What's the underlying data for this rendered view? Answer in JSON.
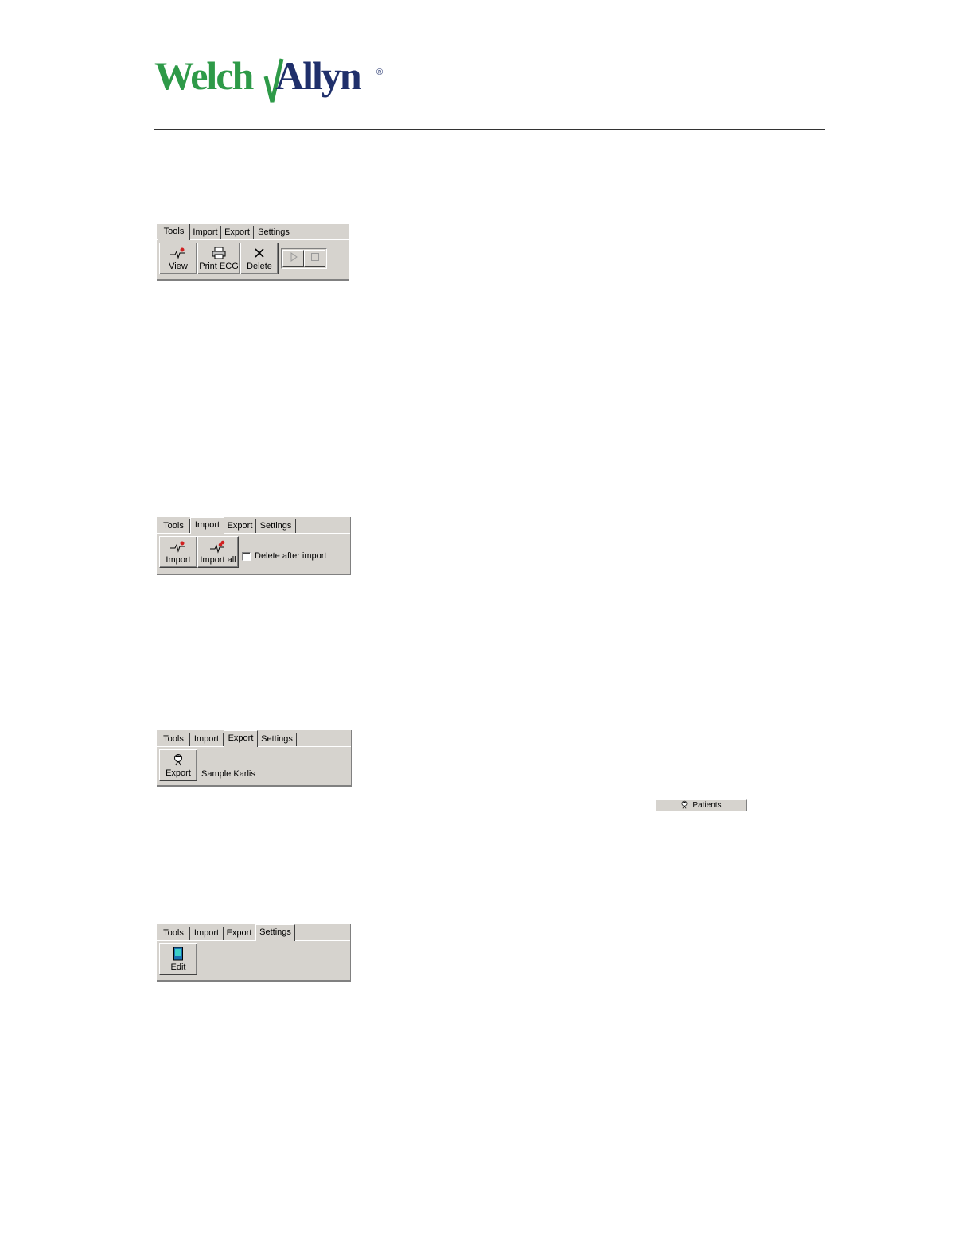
{
  "brand": {
    "logo_text_welch": "Welch",
    "logo_text_allyn": "Allyn",
    "logo_mark": "®",
    "green": "#2e9a48",
    "navy": "#1f2f6b"
  },
  "tab_labels": [
    "Tools",
    "Import",
    "Export",
    "Settings"
  ],
  "toolbars": [
    {
      "active_tab": "Tools",
      "buttons": [
        {
          "label": "View",
          "icon": "ecg-heart-icon"
        },
        {
          "label": "Print ECG",
          "icon": "printer-icon"
        },
        {
          "label": "Delete",
          "icon": "close-x-icon"
        }
      ],
      "media_buttons": [
        {
          "icon": "play-icon"
        },
        {
          "icon": "stop-icon"
        }
      ]
    },
    {
      "active_tab": "Import",
      "buttons": [
        {
          "label": "Import",
          "icon": "ecg-heart-icon"
        },
        {
          "label": "Import all",
          "icon": "ecg-heart-multi-icon"
        }
      ],
      "checkbox": {
        "label": "Delete after import",
        "checked": false
      }
    },
    {
      "active_tab": "Export",
      "buttons": [
        {
          "label": "Export",
          "icon": "patient-head-icon"
        }
      ],
      "patient_name": "Sample Karlis"
    },
    {
      "active_tab": "Settings",
      "buttons": [
        {
          "label": "Edit",
          "icon": "device-icon"
        }
      ]
    }
  ],
  "patients_button": {
    "label": "Patients",
    "icon": "patient-head-icon"
  }
}
